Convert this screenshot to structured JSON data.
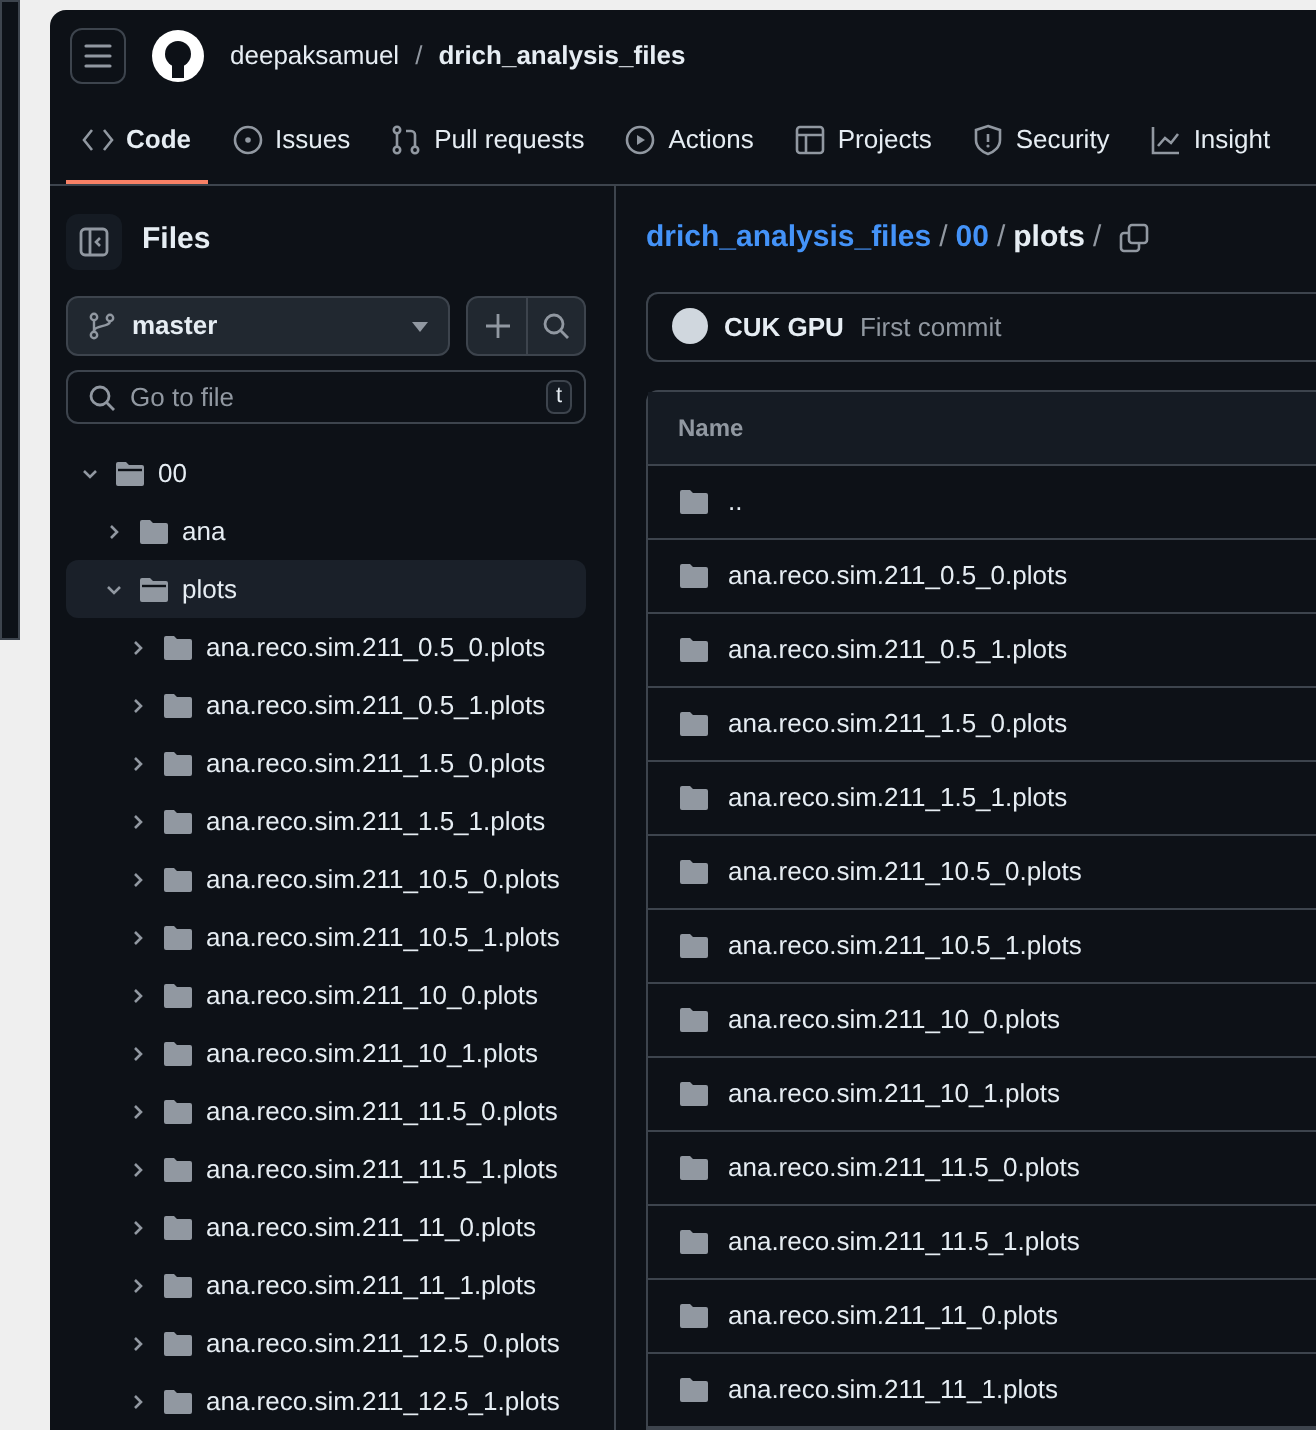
{
  "header": {
    "owner": "deepaksamuel",
    "separator": "/",
    "repo": "drich_analysis_files"
  },
  "tabs": [
    {
      "label": "Code",
      "selected": true
    },
    {
      "label": "Issues",
      "selected": false
    },
    {
      "label": "Pull requests",
      "selected": false
    },
    {
      "label": "Actions",
      "selected": false
    },
    {
      "label": "Projects",
      "selected": false
    },
    {
      "label": "Security",
      "selected": false
    },
    {
      "label": "Insight",
      "selected": false
    }
  ],
  "sidebar": {
    "title": "Files",
    "branch": "master",
    "search": {
      "placeholder": "Go to file",
      "shortcut": "t"
    },
    "tree": [
      {
        "name": "00",
        "expanded": true,
        "selected": false,
        "children": [
          {
            "name": "ana",
            "expanded": false,
            "selected": false
          },
          {
            "name": "plots",
            "expanded": true,
            "selected": true,
            "children": [
              {
                "name": "ana.reco.sim.211_0.5_0.plots",
                "expanded": false,
                "selected": false
              },
              {
                "name": "ana.reco.sim.211_0.5_1.plots",
                "expanded": false,
                "selected": false
              },
              {
                "name": "ana.reco.sim.211_1.5_0.plots",
                "expanded": false,
                "selected": false
              },
              {
                "name": "ana.reco.sim.211_1.5_1.plots",
                "expanded": false,
                "selected": false
              },
              {
                "name": "ana.reco.sim.211_10.5_0.plots",
                "expanded": false,
                "selected": false
              },
              {
                "name": "ana.reco.sim.211_10.5_1.plots",
                "expanded": false,
                "selected": false
              },
              {
                "name": "ana.reco.sim.211_10_0.plots",
                "expanded": false,
                "selected": false
              },
              {
                "name": "ana.reco.sim.211_10_1.plots",
                "expanded": false,
                "selected": false
              },
              {
                "name": "ana.reco.sim.211_11.5_0.plots",
                "expanded": false,
                "selected": false
              },
              {
                "name": "ana.reco.sim.211_11.5_1.plots",
                "expanded": false,
                "selected": false
              },
              {
                "name": "ana.reco.sim.211_11_0.plots",
                "expanded": false,
                "selected": false
              },
              {
                "name": "ana.reco.sim.211_11_1.plots",
                "expanded": false,
                "selected": false
              },
              {
                "name": "ana.reco.sim.211_12.5_0.plots",
                "expanded": false,
                "selected": false
              },
              {
                "name": "ana.reco.sim.211_12.5_1.plots",
                "expanded": false,
                "selected": false
              }
            ]
          }
        ]
      }
    ]
  },
  "breadcrumb": {
    "separator": "/",
    "parts": [
      {
        "label": "drich_analysis_files",
        "kind": "link"
      },
      {
        "label": "00",
        "kind": "link"
      },
      {
        "label": "plots",
        "kind": "current"
      }
    ]
  },
  "commit": {
    "author": "CUK GPU",
    "message": "First commit"
  },
  "table": {
    "columns": [
      "Name"
    ],
    "rows": [
      {
        "name": ".."
      },
      {
        "name": "ana.reco.sim.211_0.5_0.plots"
      },
      {
        "name": "ana.reco.sim.211_0.5_1.plots"
      },
      {
        "name": "ana.reco.sim.211_1.5_0.plots"
      },
      {
        "name": "ana.reco.sim.211_1.5_1.plots"
      },
      {
        "name": "ana.reco.sim.211_10.5_0.plots"
      },
      {
        "name": "ana.reco.sim.211_10.5_1.plots"
      },
      {
        "name": "ana.reco.sim.211_10_0.plots"
      },
      {
        "name": "ana.reco.sim.211_10_1.plots"
      },
      {
        "name": "ana.reco.sim.211_11.5_0.plots"
      },
      {
        "name": "ana.reco.sim.211_11.5_1.plots"
      },
      {
        "name": "ana.reco.sim.211_11_0.plots"
      },
      {
        "name": "ana.reco.sim.211_11_1.plots"
      }
    ]
  }
}
